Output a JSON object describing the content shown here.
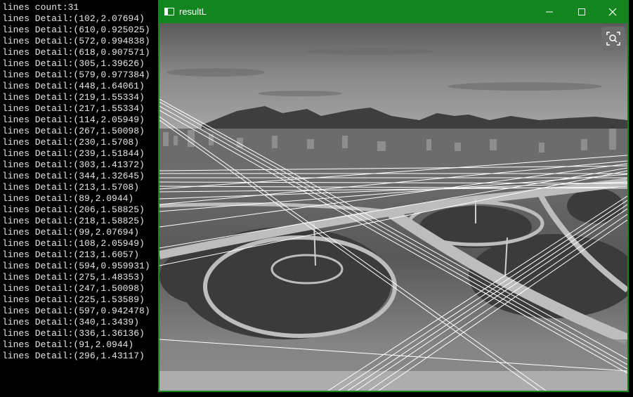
{
  "console": {
    "lines": [
      "lines count:31",
      "lines Detail:(102,2.07694)",
      "lines Detail:(610,0.925025)",
      "lines Detail:(572,0.994838)",
      "lines Detail:(618,0.907571)",
      "lines Detail:(305,1.39626)",
      "lines Detail:(579,0.977384)",
      "lines Detail:(448,1.64061)",
      "lines Detail:(219,1.55334)",
      "lines Detail:(217,1.55334)",
      "lines Detail:(114,2.05949)",
      "lines Detail:(267,1.50098)",
      "lines Detail:(230,1.5708)",
      "lines Detail:(239,1.51844)",
      "lines Detail:(303,1.41372)",
      "lines Detail:(344,1.32645)",
      "lines Detail:(213,1.5708)",
      "lines Detail:(89,2.0944)",
      "lines Detail:(206,1.58825)",
      "lines Detail:(218,1.58825)",
      "lines Detail:(99,2.07694)",
      "lines Detail:(108,2.05949)",
      "lines Detail:(213,1.6057)",
      "lines Detail:(594,0.959931)",
      "lines Detail:(275,1.48353)",
      "lines Detail:(247,1.50098)",
      "lines Detail:(225,1.53589)",
      "lines Detail:(597,0.942478)",
      "lines Detail:(340,1.3439)",
      "lines Detail:(336,1.36136)",
      "lines Detail:(91,2.0944)",
      "lines Detail:(296,1.43117)"
    ]
  },
  "window": {
    "title": "resultL",
    "accent_color": "#13851e",
    "controls": [
      "minimize-icon",
      "maximize-icon",
      "close-icon"
    ],
    "zoom_icon": "zoom-search-icon"
  }
}
